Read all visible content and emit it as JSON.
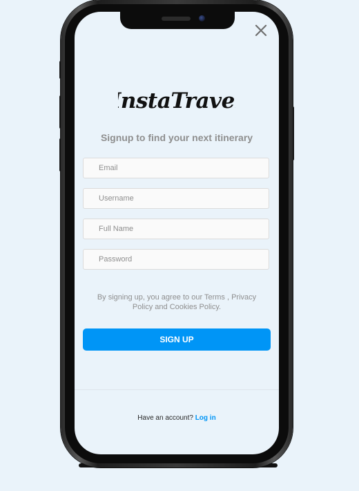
{
  "app": {
    "logo_text": "InstaTravel",
    "subtitle": "Signup to find your next itinerary"
  },
  "form": {
    "email_placeholder": "Email",
    "username_placeholder": "Username",
    "fullname_placeholder": "Full Name",
    "password_placeholder": "Password"
  },
  "terms": {
    "prefix": "By signing up, you agree to our ",
    "terms_label": "Terms",
    "separator": " , ",
    "privacy_label": "Privacy Policy",
    "conjunction": " and ",
    "cookies_label": "Cookies Policy",
    "suffix": "."
  },
  "signup_button": "SIGN UP",
  "footer": {
    "prompt": "Have an account?",
    "login_label": "Log in"
  },
  "icons": {
    "close": "close-icon"
  },
  "colors": {
    "accent": "#0095f6",
    "background": "#eaf3fa",
    "muted_text": "#8e8e8e"
  }
}
